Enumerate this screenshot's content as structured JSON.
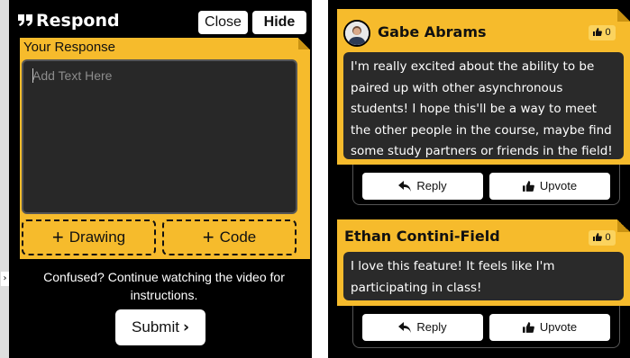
{
  "respond_panel": {
    "title": "Respond",
    "close_label": "Close",
    "hide_label": "Hide",
    "response_label": "Your Response",
    "textarea_placeholder": "Add Text Here",
    "add_drawing_label": "Drawing",
    "add_code_label": "Code",
    "plus_symbol": "+",
    "confused_text": "Confused? Continue watching the video for instructions.",
    "submit_label": "Submit",
    "submit_chevron": "›"
  },
  "comments": [
    {
      "author": "Gabe Abrams",
      "upvotes": "0",
      "body": "I'm really excited about the ability to be paired up with other asynchronous students! I hope this'll be a way to meet the other people in the course, maybe find some study partners or friends in the field!",
      "reply_label": "Reply",
      "upvote_label": "Upvote",
      "has_avatar": true
    },
    {
      "author": "Ethan Contini-Field",
      "upvotes": "0",
      "body": "I love this feature! It feels like I'm participating in class!",
      "reply_label": "Reply",
      "upvote_label": "Upvote",
      "has_avatar": false
    }
  ],
  "colors": {
    "accent_yellow": "#f6bb2c",
    "panel_black": "#000000",
    "textarea_bg": "#282828",
    "comment_body_bg": "#2a2a2a"
  },
  "icons": {
    "quote": "quote-icon",
    "thumbs_up": "thumbs-up-icon",
    "reply": "reply-arrow-icon"
  }
}
